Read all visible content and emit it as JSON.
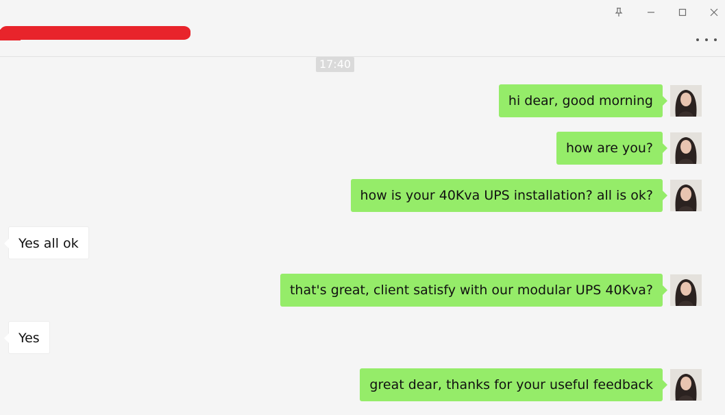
{
  "timestamp": "17:40",
  "messages": [
    {
      "direction": "out",
      "text": "hi dear, good morning"
    },
    {
      "direction": "out",
      "text": "how are you?"
    },
    {
      "direction": "out",
      "text": "how is your 40Kva UPS installation? all is ok?"
    },
    {
      "direction": "in",
      "text": "Yes all ok"
    },
    {
      "direction": "out",
      "text": "that's great, client satisfy with our modular UPS 40Kva?"
    },
    {
      "direction": "in",
      "text": "Yes"
    },
    {
      "direction": "out",
      "text": "great dear, thanks for your useful feedback"
    }
  ],
  "icons": {
    "pin": "pin-icon",
    "minimize": "minimize-icon",
    "maximize": "maximize-icon",
    "close": "close-icon",
    "more": "more-options-icon"
  },
  "colors": {
    "outgoing_bubble": "#95ec69",
    "incoming_bubble": "#ffffff",
    "background": "#f5f5f5",
    "redaction": "#e8242b"
  }
}
